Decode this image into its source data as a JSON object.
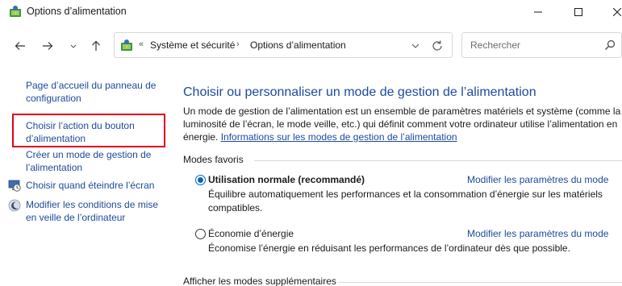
{
  "window": {
    "title": "Options d’alimentation"
  },
  "address_bar": {
    "overflow_chevron": "«",
    "crumbs": [
      "Système et sécurité",
      "Options d’alimentation"
    ],
    "separator": "›"
  },
  "search": {
    "placeholder": "Rechercher"
  },
  "sidebar": {
    "items": [
      {
        "label": "Page d’accueil du panneau de configuration",
        "icon": null
      },
      {
        "label": "Choisir l’action du bouton d’alimentation",
        "icon": null,
        "highlighted": true
      },
      {
        "label": "Créer un mode de gestion de l’alimentation",
        "icon": null
      },
      {
        "label": "Choisir quand éteindre l’écran",
        "icon": "monitor-clock-icon"
      },
      {
        "label": "Modifier les conditions de mise en veille de l’ordinateur",
        "icon": "moon-icon"
      }
    ]
  },
  "main": {
    "heading": "Choisir ou personnaliser un mode de gestion de l’alimentation",
    "description": "Un mode de gestion de l’alimentation est un ensemble de paramètres matériels et système (comme la luminosité de l’écran, le mode veille, etc.) qui définit comment votre ordinateur utilise l’alimentation en énergie.",
    "description_link": "Informations sur les modes de gestion de l’alimentation",
    "favorites_title": "Modes favoris",
    "plans": [
      {
        "name": "Utilisation normale (recommandé)",
        "selected": true,
        "change_link": "Modifier les paramètres du mode",
        "description": "Équilibre automatiquement les performances et la consommation d’énergie sur les matériels compatibles."
      },
      {
        "name": "Économie d’énergie",
        "selected": false,
        "change_link": "Modifier les paramètres du mode",
        "description": "Économise l’énergie en réduisant les performances de l’ordinateur dès que possible."
      }
    ],
    "more_plans_title": "Afficher les modes supplémentaires"
  },
  "colors": {
    "link": "#1c4a9b",
    "highlight_box": "#e0001b",
    "radio_accent": "#0067c0"
  }
}
